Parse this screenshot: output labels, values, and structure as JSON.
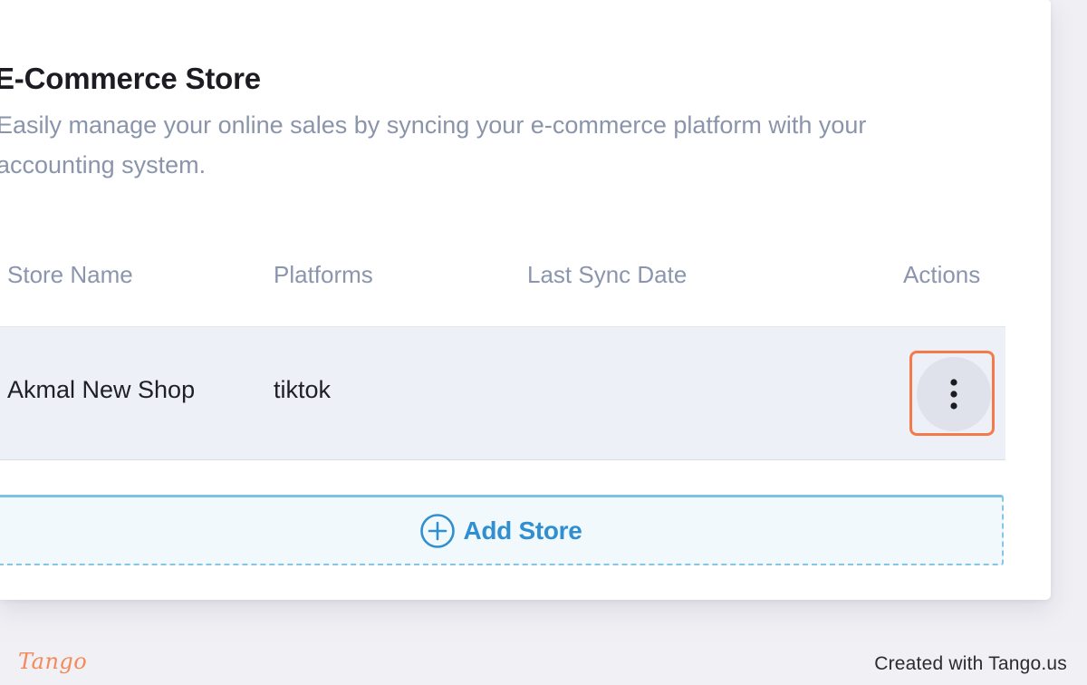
{
  "section": {
    "title": "E-Commerce Store",
    "description": "Easily manage your online sales by syncing your e-commerce platform with your accounting system."
  },
  "table": {
    "columns": [
      "Store Name",
      "Platforms",
      "Last Sync Date",
      "Actions"
    ],
    "rows": [
      {
        "store_name": "Akmal New Shop",
        "platform": "tiktok",
        "last_sync_date": ""
      }
    ]
  },
  "add_store": {
    "label": "Add Store",
    "icon": "plus-circle-icon"
  },
  "row_actions_icon": "more-vertical-icon",
  "footer": {
    "brand": "Tango",
    "credit": "Created with Tango.us"
  },
  "colors": {
    "accent": "#2f8fd0",
    "highlight": "#f47a4c",
    "muted_text": "#8b95ad",
    "row_background": "#edf0f7"
  }
}
